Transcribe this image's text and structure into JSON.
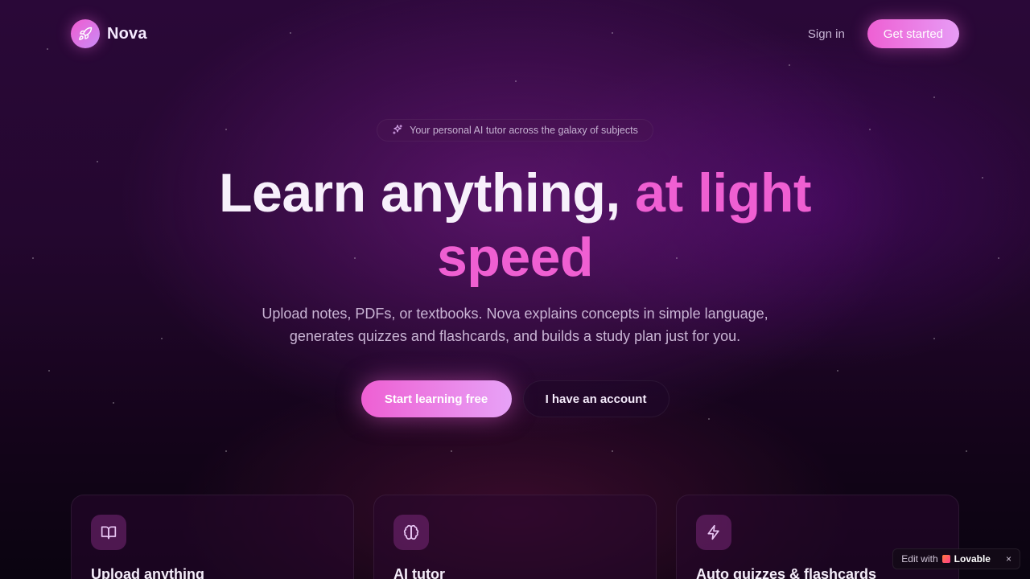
{
  "nav": {
    "brand": "Nova",
    "sign_in": "Sign in",
    "get_started": "Get started"
  },
  "hero": {
    "badge": "Your personal AI tutor across the galaxy of subjects",
    "headline_main": "Learn anything,",
    "headline_accent_1": "at light",
    "headline_accent_2": "speed",
    "subtext_line1": "Upload notes, PDFs, or textbooks. Nova explains concepts in simple language,",
    "subtext_line2": "generates quizzes and flashcards, and builds a study plan just for you.",
    "cta_primary": "Start learning free",
    "cta_secondary": "I have an account"
  },
  "features": [
    {
      "icon": "book-open-icon",
      "title": "Upload anything"
    },
    {
      "icon": "brain-icon",
      "title": "AI tutor"
    },
    {
      "icon": "lightning-icon",
      "title": "Auto quizzes & flashcards"
    }
  ],
  "lovable": {
    "prefix": "Edit with",
    "brand": "Lovable",
    "close": "×"
  },
  "colors": {
    "accent": "#ef5fd2",
    "accent_light": "#e79cf6",
    "background": "#24072f"
  }
}
